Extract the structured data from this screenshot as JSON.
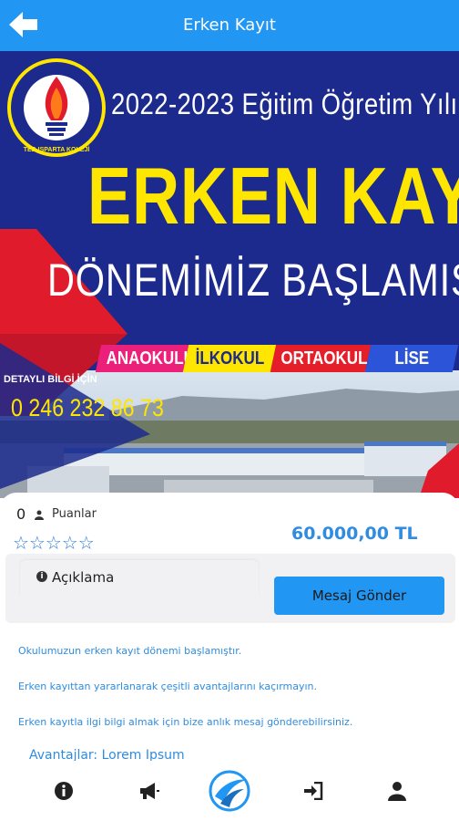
{
  "header": {
    "title": "Erken Kayıt",
    "back_icon": "arrow-left-icon"
  },
  "banner": {
    "logo_text": "TED ISPARTA KOLEJİ",
    "year_line": "2022-2023 Eğitim Öğretim  Yılı",
    "headline": "ERKEN KAYIT",
    "subline": "DÖNEMİMİZ BAŞLAMIŞTIR",
    "levels": [
      "ANAOKULU",
      "İLKOKUL",
      "ORTAOKUL",
      "LİSE"
    ],
    "level_colors": [
      "#ec1f7b",
      "#ffe600",
      "#e51e2a",
      "#2c54d8"
    ],
    "detail_label": "DETAYLI BİLGİ İÇİN",
    "phone": "0 246 232 86 73"
  },
  "product": {
    "points_count": "0",
    "points_label": "Puanlar",
    "stars": "☆☆☆☆☆",
    "rating": 0,
    "price": "60.000,00 TL",
    "description_tab": "Açıklama",
    "message_button": "Mesaj Gönder"
  },
  "description": {
    "paragraphs": [
      "Okulumuzun erken kayıt dönemi başlamıştır.",
      "Erken kayıttan yararlanarak çeşitli avantajlarını kaçırmayın.",
      "Erken kayıtla ilgi bilgi almak için bize anlık mesaj gönderebilirsiniz."
    ],
    "partial_line": "Avantajlar: Lorem Ipsum"
  },
  "bottom_nav": {
    "items": [
      {
        "icon": "info-icon"
      },
      {
        "icon": "megaphone-icon"
      },
      {
        "icon": "app-logo-icon"
      },
      {
        "icon": "login-icon"
      },
      {
        "icon": "user-icon"
      }
    ]
  },
  "colors": {
    "primary": "#2196f3",
    "accent_text": "#2f8ce0",
    "banner_bg": "#1a2a8a",
    "headline_yellow": "#ffe600"
  }
}
